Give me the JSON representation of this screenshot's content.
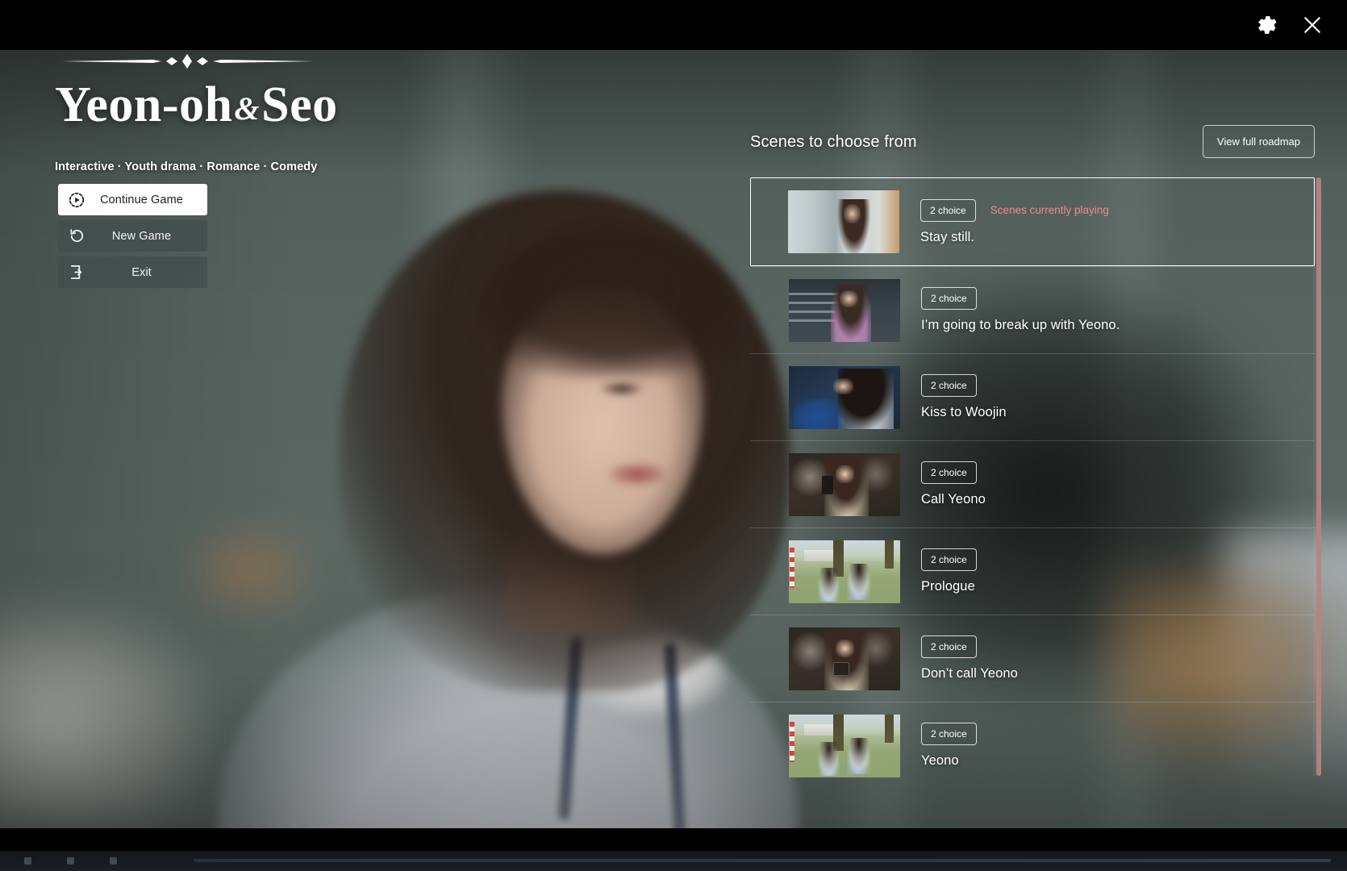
{
  "window": {
    "chrome_icons": [
      {
        "name": "settings-gear-icon",
        "label": "Settings"
      },
      {
        "name": "close-icon",
        "label": "Close"
      }
    ]
  },
  "title_block": {
    "game_title_main": "Yeon-oh",
    "game_title_amp": "&",
    "game_title_end": "Seo",
    "genres": "Interactive · Youth drama · Romance · Comedy"
  },
  "menu": {
    "items": [
      {
        "label": "Continue Game",
        "icon": "play-in-dashed-circle-icon",
        "state": "active"
      },
      {
        "label": "New Game",
        "icon": "restart-arrow-icon",
        "state": "normal"
      },
      {
        "label": "Exit",
        "icon": "exit-door-arrow-icon",
        "state": "normal"
      }
    ]
  },
  "scenes": {
    "heading": "Scenes to choose from",
    "roadmap_button": "View full roadmap",
    "now_playing_label": "Scenes currently playing",
    "accent_color": "#ef8b87",
    "scrollbar_color": "#b78382",
    "items": [
      {
        "title": "Stay still.",
        "choice": "2 choice",
        "current": true,
        "thumb": "office"
      },
      {
        "title": "I’m going to break up with Yeono.",
        "choice": "2 choice",
        "current": false,
        "thumb": "night"
      },
      {
        "title": "Kiss to Woojin",
        "choice": "2 choice",
        "current": false,
        "thumb": "kiss"
      },
      {
        "title": "Call Yeono",
        "choice": "2 choice",
        "current": false,
        "thumb": "cafe"
      },
      {
        "title": "Prologue",
        "choice": "2 choice",
        "current": false,
        "thumb": "park"
      },
      {
        "title": "Don’t call Yeono",
        "choice": "2 choice",
        "current": false,
        "thumb": "cafe2"
      },
      {
        "title": "Yeono",
        "choice": "2 choice",
        "current": false,
        "thumb": "park2"
      }
    ]
  }
}
